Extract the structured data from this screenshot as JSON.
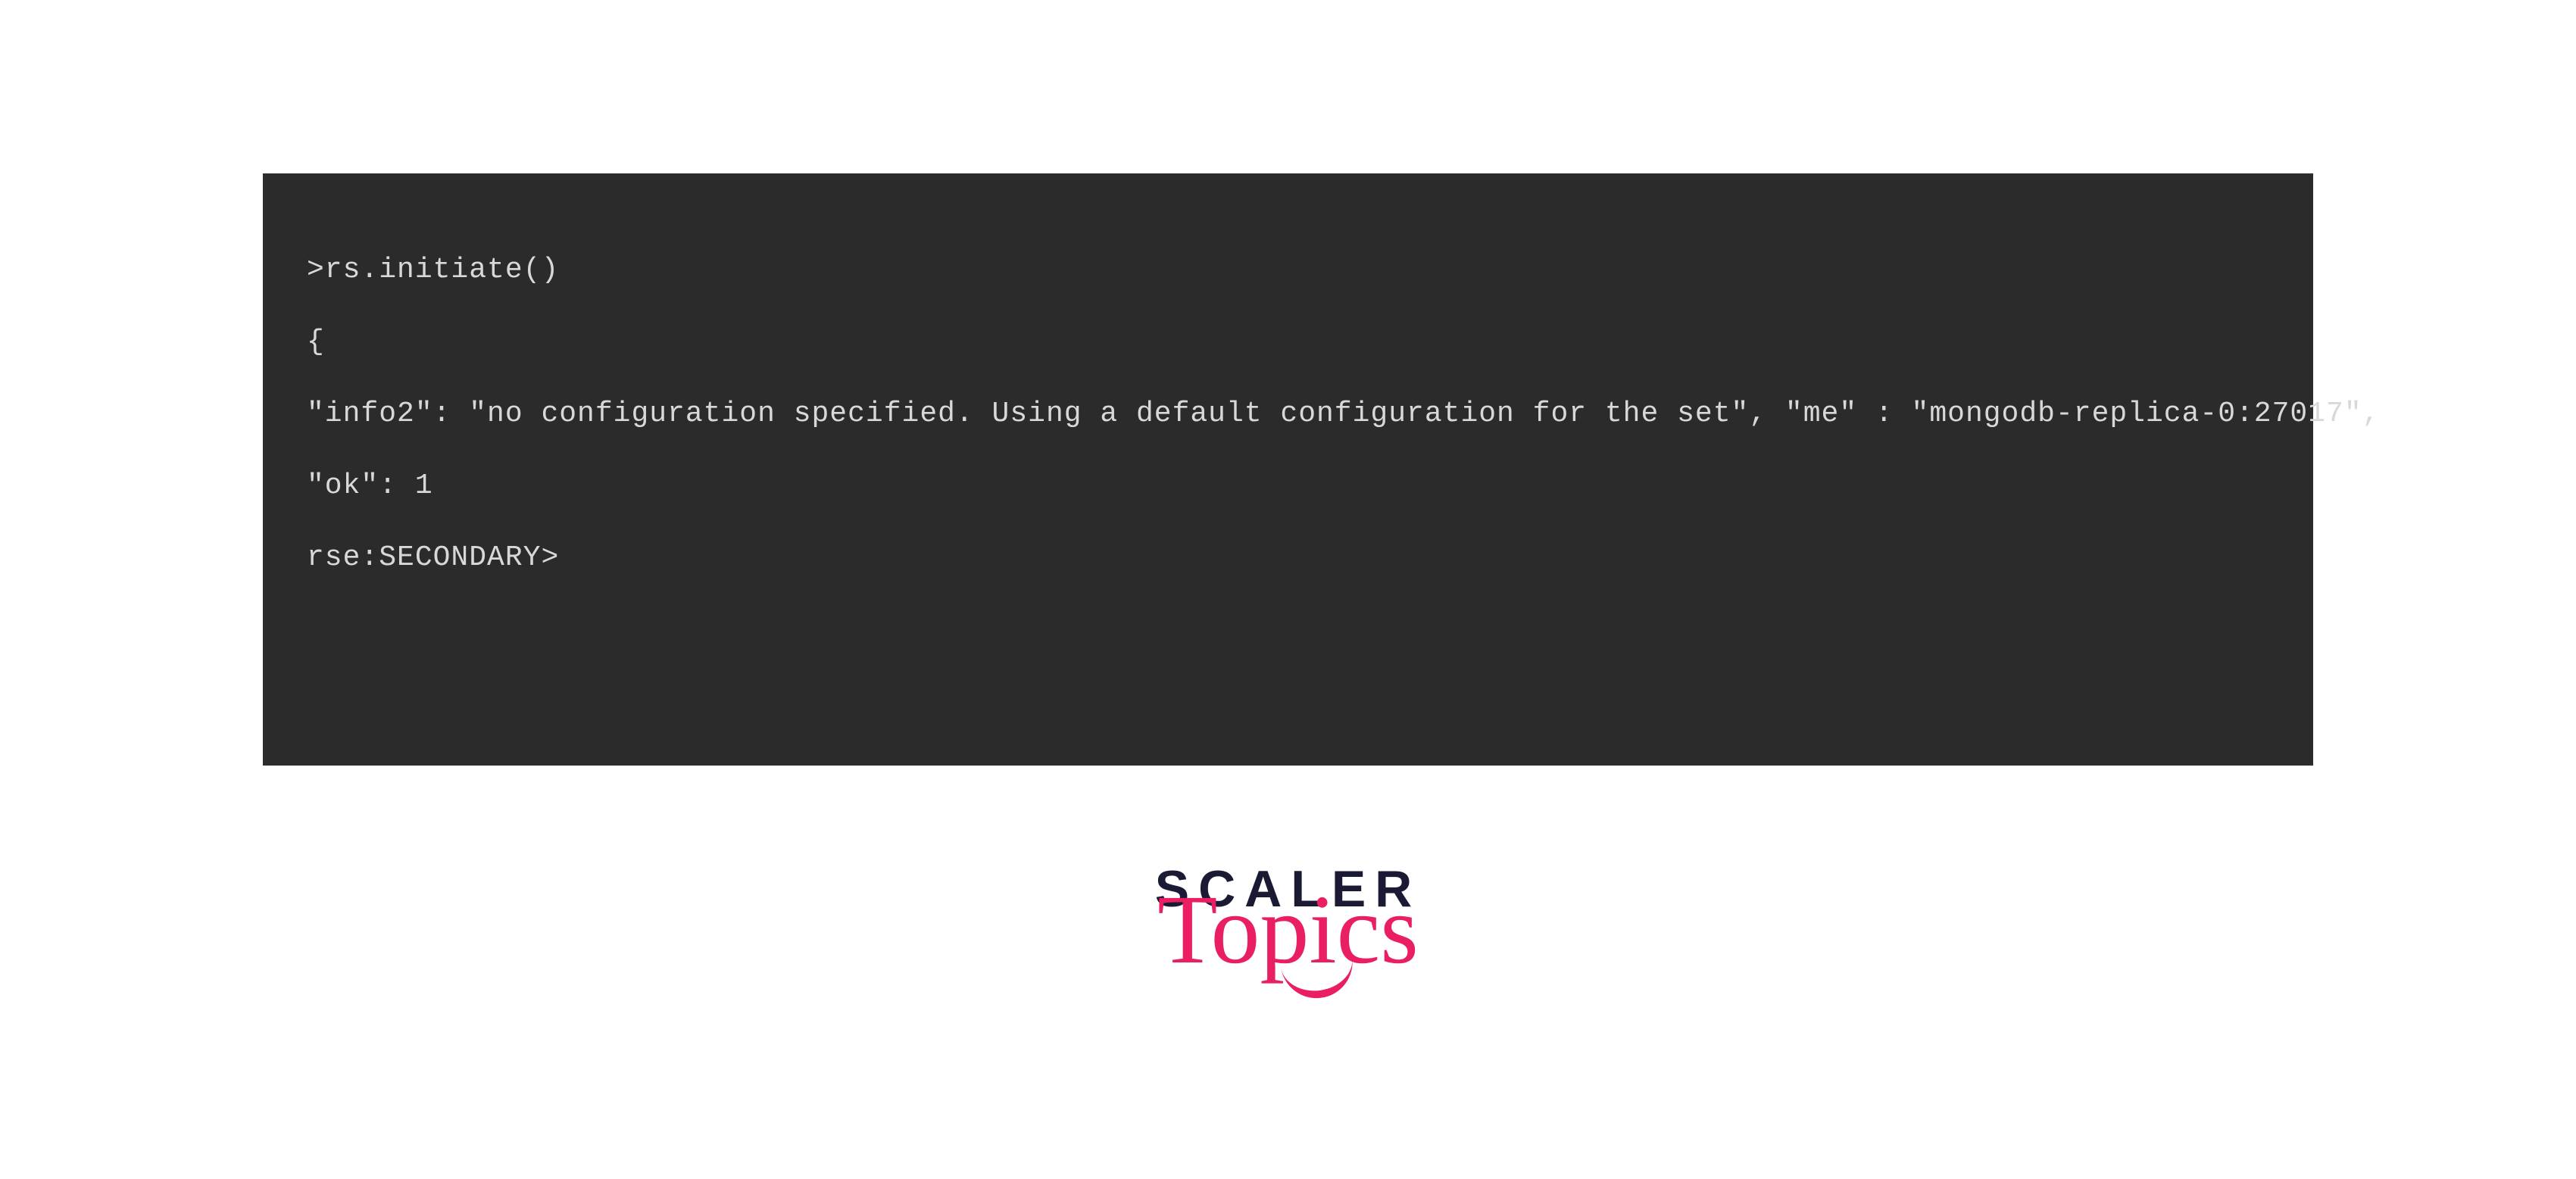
{
  "code": {
    "line1": ">rs.initiate()",
    "line2": "{",
    "line3": "\"info2\": \"no configuration specified. Using a default configuration for the set\", \"me\" : \"mongodb-replica-0:27017\",",
    "line4": "\"ok\": 1",
    "line5": "rse:SECONDARY>"
  },
  "logo": {
    "top": "SCALER",
    "bottom": "Topics"
  }
}
